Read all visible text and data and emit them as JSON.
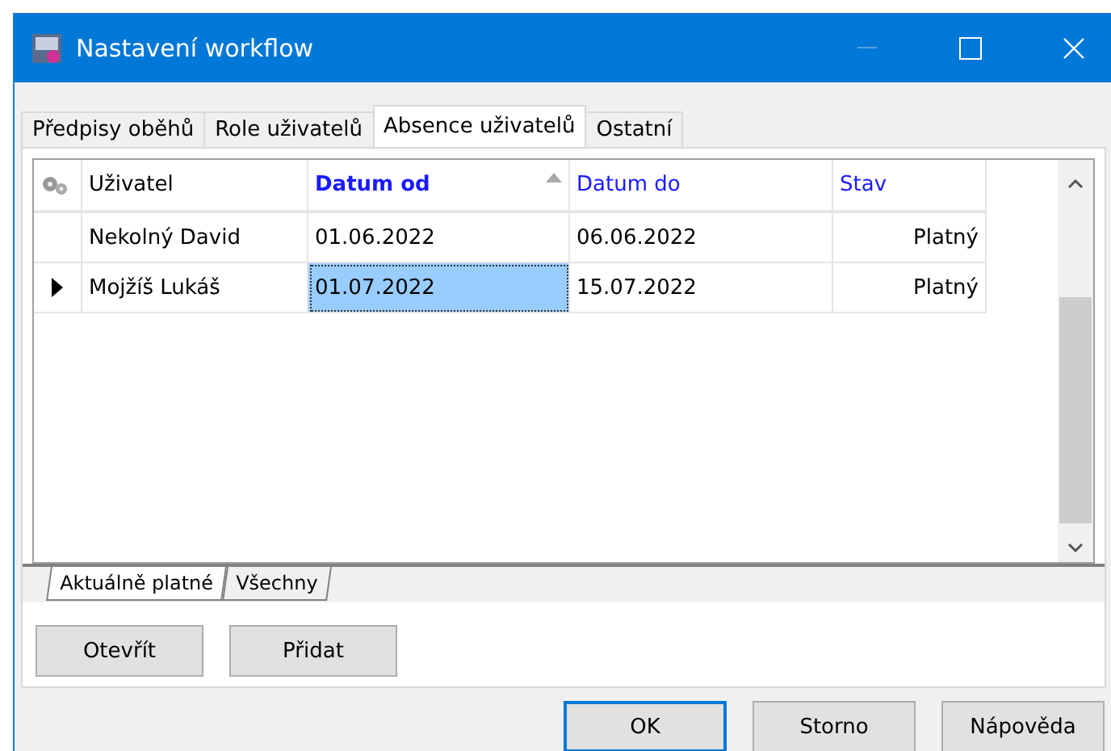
{
  "window": {
    "title": "Nastavení workflow"
  },
  "tabs": [
    {
      "label": "Předpisy oběhů",
      "selected": false
    },
    {
      "label": "Role uživatelů",
      "selected": false
    },
    {
      "label": "Absence uživatelů",
      "selected": true
    },
    {
      "label": "Ostatní",
      "selected": false
    }
  ],
  "table": {
    "columns": [
      {
        "label": "Uživatel",
        "color": "#000000",
        "sorted": false
      },
      {
        "label": "Datum od",
        "color": "#1a1aff",
        "sorted": true
      },
      {
        "label": "Datum do",
        "color": "#1a1aff",
        "sorted": false
      },
      {
        "label": "Stav",
        "color": "#1a1aff",
        "sorted": false
      }
    ],
    "rows": [
      {
        "selected": false,
        "cells": [
          {
            "text": "Nekolný David",
            "focused": false
          },
          {
            "text": "01.06.2022",
            "focused": false
          },
          {
            "text": "06.06.2022",
            "focused": false
          },
          {
            "text": "Platný",
            "focused": false
          }
        ]
      },
      {
        "selected": true,
        "cells": [
          {
            "text": "Mojžíš Lukáš",
            "focused": false
          },
          {
            "text": "01.07.2022",
            "focused": true
          },
          {
            "text": "15.07.2022",
            "focused": false
          },
          {
            "text": "Platný",
            "focused": false
          }
        ]
      }
    ]
  },
  "sheet_tabs": [
    {
      "label": "Aktuálně platné",
      "selected": true
    },
    {
      "label": "Všechny",
      "selected": false
    }
  ],
  "panel_buttons": [
    "Otevřít",
    "Přidat"
  ],
  "dialog_buttons": [
    {
      "label": "OK",
      "default": true
    },
    {
      "label": "Storno",
      "default": false
    },
    {
      "label": "Nápověda",
      "default": false
    }
  ]
}
